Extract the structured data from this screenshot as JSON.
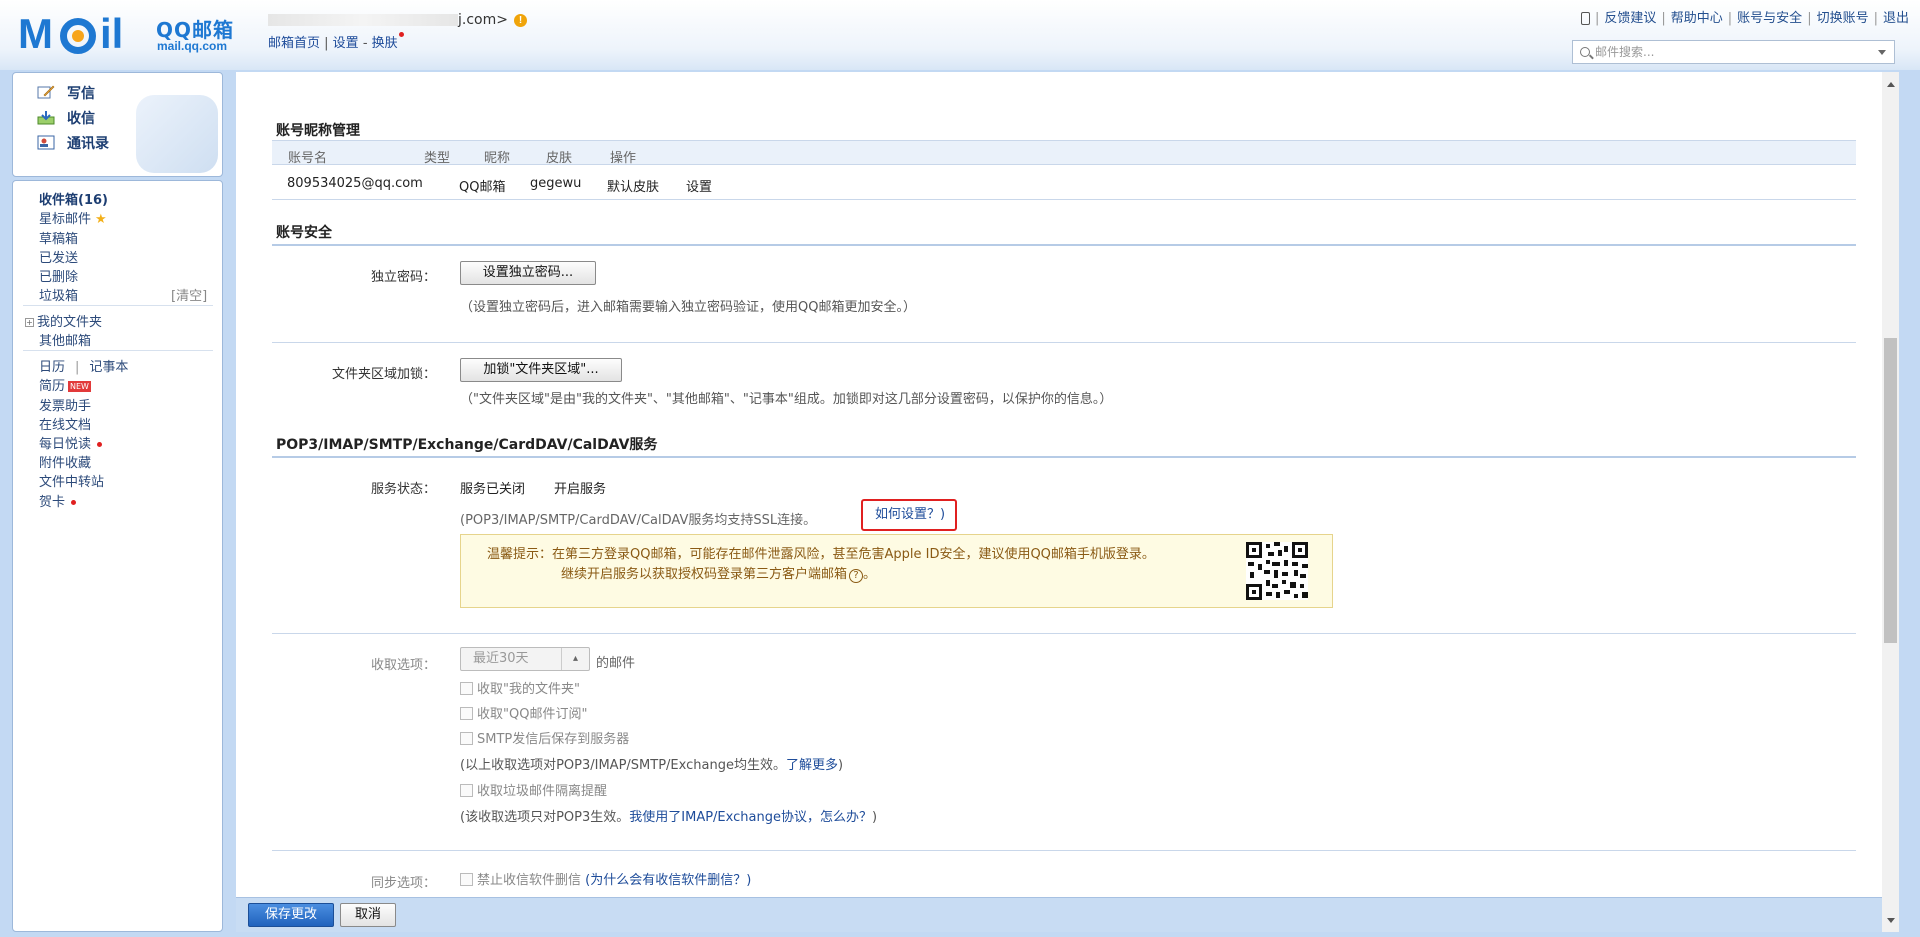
{
  "header": {
    "logo_cn": "QQ邮箱",
    "logo_url": "mail.qq.com",
    "account_suffix": "j.com>",
    "links": {
      "home": "邮箱首页",
      "sep": " | ",
      "settings": "设置",
      "dash": " - ",
      "skin": "换肤"
    },
    "right_links": [
      "反馈建议",
      "帮助中心",
      "账号与安全",
      "切换账号",
      "退出"
    ],
    "search_placeholder": "邮件搜索..."
  },
  "sidebar": {
    "commands": {
      "compose": "写信",
      "receive": "收信",
      "contacts": "通讯录"
    },
    "folders": {
      "inbox": "收件箱(16)",
      "starred": "星标邮件",
      "drafts": "草稿箱",
      "sent": "已发送",
      "deleted": "已删除",
      "spam": "垃圾箱",
      "spam_clear": "[清空]",
      "my_folders": "我的文件夹",
      "other_mail": "其他邮箱"
    },
    "apps": {
      "calendar": "日历",
      "notebook": "记事本",
      "resume": "简历",
      "new_badge": "NEW",
      "invoice": "发票助手",
      "docs": "在线文档",
      "daily": "每日悦读",
      "attachments": "附件收藏",
      "transfer": "文件中转站",
      "cards": "贺卡"
    }
  },
  "account_nickname": {
    "title": "账号昵称管理",
    "headers": [
      "账号名",
      "类型",
      "昵称",
      "皮肤",
      "操作"
    ],
    "row": {
      "account": "809534025@qq.com",
      "type": "QQ邮箱",
      "nickname": "gegewu",
      "skin": "默认皮肤",
      "action": "设置"
    }
  },
  "security": {
    "title": "账号安全",
    "password_label": "独立密码：",
    "password_button": "设置独立密码...",
    "password_note": "（设置独立密码后，进入邮箱需要输入独立密码验证，使用QQ邮箱更加安全。）",
    "folder_lock_label": "文件夹区域加锁：",
    "folder_lock_button": "加锁\"文件夹区域\"...",
    "folder_lock_note": "（\"文件夹区域\"是由\"我的文件夹\"、\"其他邮箱\"、\"记事本\"组成。加锁即对这几部分设置密码，以保护你的信息。）"
  },
  "service": {
    "title": "POP3/IMAP/SMTP/Exchange/CardDAV/CalDAV服务",
    "status_label": "服务状态：",
    "status_value": "服务已关闭",
    "enable_link": "开启服务",
    "ssl_note": "(POP3/IMAP/SMTP/CardDAV/CalDAV服务均支持SSL连接。",
    "howto_link": "如何设置？)",
    "tip_line1": "温馨提示：在第三方登录QQ邮箱，可能存在邮件泄露风险，甚至危害Apple ID安全，建议使用QQ邮箱手机版登录。",
    "tip_line2": "继续开启服务以获取授权码登录第三方客户端邮箱",
    "tip_help": "?"
  },
  "fetch_options": {
    "label": "收取选项：",
    "select_value": "最近30天",
    "select_suffix": "的邮件",
    "cb1": "收取\"我的文件夹\"",
    "cb2": "收取\"QQ邮件订阅\"",
    "cb3": "SMTP发信后保存到服务器",
    "note1": "(以上收取选项对POP3/IMAP/SMTP/Exchange均生效。",
    "note1_link": "了解更多",
    "note1_end": ")",
    "cb4": "收取垃圾邮件隔离提醒",
    "note2": "(该收取选项只对POP3生效。",
    "note2_link": "我使用了IMAP/Exchange协议，怎么办？",
    "note2_end": ")"
  },
  "sync_options": {
    "label": "同步选项：",
    "cb1": "禁止收信软件删信",
    "cb1_link": "(为什么会有收信软件删信？)"
  },
  "buttons": {
    "save": "保存更改",
    "cancel": "取消"
  }
}
